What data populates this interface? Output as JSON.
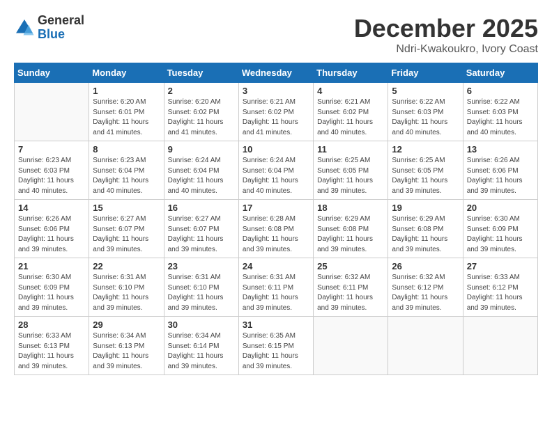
{
  "logo": {
    "general": "General",
    "blue": "Blue"
  },
  "header": {
    "month": "December 2025",
    "location": "Ndri-Kwakoukro, Ivory Coast"
  },
  "weekdays": [
    "Sunday",
    "Monday",
    "Tuesday",
    "Wednesday",
    "Thursday",
    "Friday",
    "Saturday"
  ],
  "weeks": [
    [
      {
        "day": "",
        "info": ""
      },
      {
        "day": "1",
        "info": "Sunrise: 6:20 AM\nSunset: 6:01 PM\nDaylight: 11 hours and 41 minutes."
      },
      {
        "day": "2",
        "info": "Sunrise: 6:20 AM\nSunset: 6:02 PM\nDaylight: 11 hours and 41 minutes."
      },
      {
        "day": "3",
        "info": "Sunrise: 6:21 AM\nSunset: 6:02 PM\nDaylight: 11 hours and 41 minutes."
      },
      {
        "day": "4",
        "info": "Sunrise: 6:21 AM\nSunset: 6:02 PM\nDaylight: 11 hours and 40 minutes."
      },
      {
        "day": "5",
        "info": "Sunrise: 6:22 AM\nSunset: 6:03 PM\nDaylight: 11 hours and 40 minutes."
      },
      {
        "day": "6",
        "info": "Sunrise: 6:22 AM\nSunset: 6:03 PM\nDaylight: 11 hours and 40 minutes."
      }
    ],
    [
      {
        "day": "7",
        "info": "Sunrise: 6:23 AM\nSunset: 6:03 PM\nDaylight: 11 hours and 40 minutes."
      },
      {
        "day": "8",
        "info": "Sunrise: 6:23 AM\nSunset: 6:04 PM\nDaylight: 11 hours and 40 minutes."
      },
      {
        "day": "9",
        "info": "Sunrise: 6:24 AM\nSunset: 6:04 PM\nDaylight: 11 hours and 40 minutes."
      },
      {
        "day": "10",
        "info": "Sunrise: 6:24 AM\nSunset: 6:04 PM\nDaylight: 11 hours and 40 minutes."
      },
      {
        "day": "11",
        "info": "Sunrise: 6:25 AM\nSunset: 6:05 PM\nDaylight: 11 hours and 39 minutes."
      },
      {
        "day": "12",
        "info": "Sunrise: 6:25 AM\nSunset: 6:05 PM\nDaylight: 11 hours and 39 minutes."
      },
      {
        "day": "13",
        "info": "Sunrise: 6:26 AM\nSunset: 6:06 PM\nDaylight: 11 hours and 39 minutes."
      }
    ],
    [
      {
        "day": "14",
        "info": "Sunrise: 6:26 AM\nSunset: 6:06 PM\nDaylight: 11 hours and 39 minutes."
      },
      {
        "day": "15",
        "info": "Sunrise: 6:27 AM\nSunset: 6:07 PM\nDaylight: 11 hours and 39 minutes."
      },
      {
        "day": "16",
        "info": "Sunrise: 6:27 AM\nSunset: 6:07 PM\nDaylight: 11 hours and 39 minutes."
      },
      {
        "day": "17",
        "info": "Sunrise: 6:28 AM\nSunset: 6:08 PM\nDaylight: 11 hours and 39 minutes."
      },
      {
        "day": "18",
        "info": "Sunrise: 6:29 AM\nSunset: 6:08 PM\nDaylight: 11 hours and 39 minutes."
      },
      {
        "day": "19",
        "info": "Sunrise: 6:29 AM\nSunset: 6:08 PM\nDaylight: 11 hours and 39 minutes."
      },
      {
        "day": "20",
        "info": "Sunrise: 6:30 AM\nSunset: 6:09 PM\nDaylight: 11 hours and 39 minutes."
      }
    ],
    [
      {
        "day": "21",
        "info": "Sunrise: 6:30 AM\nSunset: 6:09 PM\nDaylight: 11 hours and 39 minutes."
      },
      {
        "day": "22",
        "info": "Sunrise: 6:31 AM\nSunset: 6:10 PM\nDaylight: 11 hours and 39 minutes."
      },
      {
        "day": "23",
        "info": "Sunrise: 6:31 AM\nSunset: 6:10 PM\nDaylight: 11 hours and 39 minutes."
      },
      {
        "day": "24",
        "info": "Sunrise: 6:31 AM\nSunset: 6:11 PM\nDaylight: 11 hours and 39 minutes."
      },
      {
        "day": "25",
        "info": "Sunrise: 6:32 AM\nSunset: 6:11 PM\nDaylight: 11 hours and 39 minutes."
      },
      {
        "day": "26",
        "info": "Sunrise: 6:32 AM\nSunset: 6:12 PM\nDaylight: 11 hours and 39 minutes."
      },
      {
        "day": "27",
        "info": "Sunrise: 6:33 AM\nSunset: 6:12 PM\nDaylight: 11 hours and 39 minutes."
      }
    ],
    [
      {
        "day": "28",
        "info": "Sunrise: 6:33 AM\nSunset: 6:13 PM\nDaylight: 11 hours and 39 minutes."
      },
      {
        "day": "29",
        "info": "Sunrise: 6:34 AM\nSunset: 6:13 PM\nDaylight: 11 hours and 39 minutes."
      },
      {
        "day": "30",
        "info": "Sunrise: 6:34 AM\nSunset: 6:14 PM\nDaylight: 11 hours and 39 minutes."
      },
      {
        "day": "31",
        "info": "Sunrise: 6:35 AM\nSunset: 6:15 PM\nDaylight: 11 hours and 39 minutes."
      },
      {
        "day": "",
        "info": ""
      },
      {
        "day": "",
        "info": ""
      },
      {
        "day": "",
        "info": ""
      }
    ]
  ]
}
